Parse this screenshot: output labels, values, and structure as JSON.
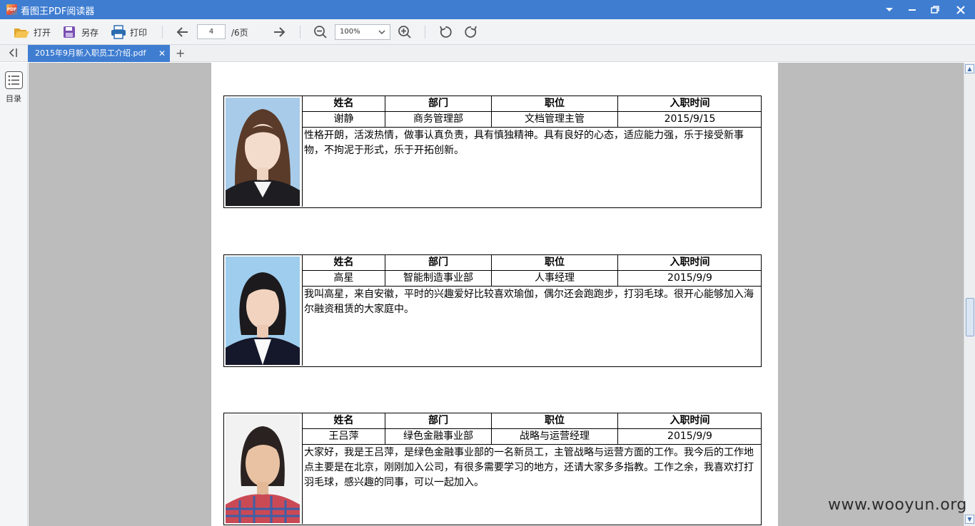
{
  "app": {
    "title": "看图王PDF阅读器",
    "icon_label": "PDF",
    "accent_color": "#3f7dd1"
  },
  "window_controls": [
    "chevron-down-icon",
    "minimize-icon",
    "restore-icon",
    "close-icon"
  ],
  "toolbar": {
    "open_label": "打开",
    "save_as_label": "另存",
    "print_label": "打印",
    "page_current": "4",
    "page_total": "/6页",
    "zoom_value": "100%"
  },
  "tabs": [
    {
      "label": "2015年9月新入职员工介绍.pdf",
      "active": true
    }
  ],
  "sidebar": {
    "toc_label": "目录"
  },
  "document": {
    "headers": {
      "name": "姓名",
      "department": "部门",
      "position": "职位",
      "hire_date": "入职时间"
    },
    "employees": [
      {
        "name": "谢静",
        "department": "商务管理部",
        "position": "文档管理主管",
        "hire_date": "2015/9/15",
        "intro": "性格开朗，活泼热情，做事认真负责，具有慎独精神。具有良好的心态，适应能力强，乐于接受新事物，不拘泥于形式，乐于开拓创新。",
        "photo_bg": "#a7cbe9"
      },
      {
        "name": "高星",
        "department": "智能制造事业部",
        "position": "人事经理",
        "hire_date": "2015/9/9",
        "intro": "我叫高星，来自安徽，平时的兴趣爱好比较喜欢瑜伽，偶尔还会跑跑步，打羽毛球。很开心能够加入海尔融资租赁的大家庭中。",
        "photo_bg": "#9fcdee"
      },
      {
        "name": "王吕萍",
        "department": "绿色金融事业部",
        "position": "战略与运营经理",
        "hire_date": "2015/9/9",
        "intro": "大家好，我是王吕萍，是绿色金融事业部的一名新员工，主管战略与运营方面的工作。我今后的工作地点主要是在北京，刚刚加入公司，有很多需要学习的地方，还请大家多多指教。工作之余，我喜欢打打羽毛球，感兴趣的同事，可以一起加入。",
        "photo_bg": "#f2f2f2"
      }
    ]
  },
  "watermark": "www.wooyun.org"
}
